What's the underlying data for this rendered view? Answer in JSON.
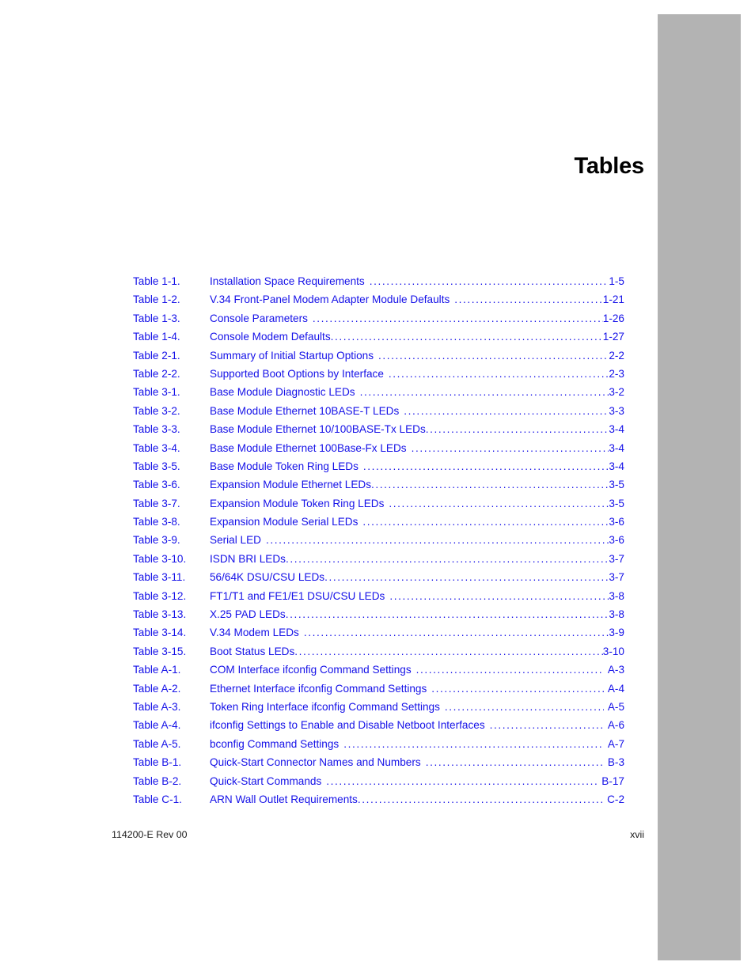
{
  "document": {
    "page_title": "Tables",
    "accent_color": "#1511e8",
    "side_tab_color": "#b3b3b3"
  },
  "toc": {
    "entries": [
      {
        "label": "Table 1-1.",
        "description": "Installation Space Requirements",
        "page": "1-5",
        "gap": true
      },
      {
        "label": "Table 1-2.",
        "description": "V.34 Front-Panel Modem Adapter Module Defaults",
        "page": "1-21",
        "gap": true
      },
      {
        "label": "Table 1-3.",
        "description": "Console Parameters",
        "page": "1-26",
        "gap": true
      },
      {
        "label": "Table 1-4.",
        "description": "Console Modem Defaults",
        "page": "1-27",
        "gap": false
      },
      {
        "label": "Table 2-1.",
        "description": "Summary of Initial Startup Options",
        "page": "2-2",
        "gap": true
      },
      {
        "label": "Table 2-2.",
        "description": "Supported Boot Options by Interface",
        "page": "2-3",
        "gap": true
      },
      {
        "label": "Table 3-1.",
        "description": "Base Module Diagnostic LEDs",
        "page": "3-2",
        "gap": true
      },
      {
        "label": "Table 3-2.",
        "description": "Base Module Ethernet 10BASE-T LEDs",
        "page": "3-3",
        "gap": true
      },
      {
        "label": "Table 3-3.",
        "description": "Base Module Ethernet 10/100BASE-Tx LEDs",
        "page": "3-4",
        "gap": false
      },
      {
        "label": "Table 3-4.",
        "description": "Base Module Ethernet 100Base-Fx LEDs",
        "page": "3-4",
        "gap": true
      },
      {
        "label": "Table 3-5.",
        "description": "Base Module Token Ring LEDs",
        "page": "3-4",
        "gap": true
      },
      {
        "label": "Table 3-6.",
        "description": "Expansion Module Ethernet LEDs",
        "page": "3-5",
        "gap": false
      },
      {
        "label": "Table 3-7.",
        "description": "Expansion Module Token Ring LEDs",
        "page": "3-5",
        "gap": true
      },
      {
        "label": "Table 3-8.",
        "description": "Expansion Module Serial LEDs",
        "page": "3-6",
        "gap": true
      },
      {
        "label": "Table 3-9.",
        "description": "Serial LED",
        "page": "3-6",
        "gap": true
      },
      {
        "label": "Table 3-10.",
        "description": "ISDN BRI LEDs",
        "page": "3-7",
        "gap": false
      },
      {
        "label": "Table 3-11.",
        "description": "56/64K DSU/CSU LEDs",
        "page": "3-7",
        "gap": false
      },
      {
        "label": "Table 3-12.",
        "description": "FT1/T1 and FE1/E1 DSU/CSU LEDs",
        "page": "3-8",
        "gap": true
      },
      {
        "label": "Table 3-13.",
        "description": "X.25 PAD LEDs",
        "page": "3-8",
        "gap": false
      },
      {
        "label": "Table 3-14.",
        "description": "V.34 Modem LEDs",
        "page": "3-9",
        "gap": true
      },
      {
        "label": "Table 3-15.",
        "description": "Boot Status LEDs",
        "page": "3-10",
        "gap": false
      },
      {
        "label": "Table A-1.",
        "description": "COM Interface ifconfig Command Settings",
        "page": "A-3",
        "gap": true,
        "page_spaced": true
      },
      {
        "label": "Table A-2.",
        "description": "Ethernet Interface ifconfig Command Settings",
        "page": "A-4",
        "gap": true,
        "page_spaced": true
      },
      {
        "label": "Table A-3.",
        "description": "Token Ring Interface ifconfig Command Settings",
        "page": "A-5",
        "gap": true,
        "page_spaced": true
      },
      {
        "label": "Table A-4.",
        "description": "ifconfig Settings to Enable and Disable Netboot Interfaces",
        "page": "A-6",
        "gap": true,
        "page_spaced": true
      },
      {
        "label": "Table A-5.",
        "description": "bconfig Command Settings",
        "page": "A-7",
        "gap": true,
        "page_spaced": true
      },
      {
        "label": "Table B-1.",
        "description": "Quick-Start Connector Names and Numbers",
        "page": "B-3",
        "gap": true,
        "page_spaced": true
      },
      {
        "label": "Table B-2.",
        "description": "Quick-Start Commands",
        "page": "B-17",
        "gap": true,
        "page_spaced": true
      },
      {
        "label": "Table C-1.",
        "description": "ARN Wall Outlet Requirements",
        "page": "C-2",
        "gap": false,
        "page_spaced": true
      }
    ]
  },
  "footer": {
    "document_number": "114200-E Rev 00",
    "page_number": "xvii"
  }
}
